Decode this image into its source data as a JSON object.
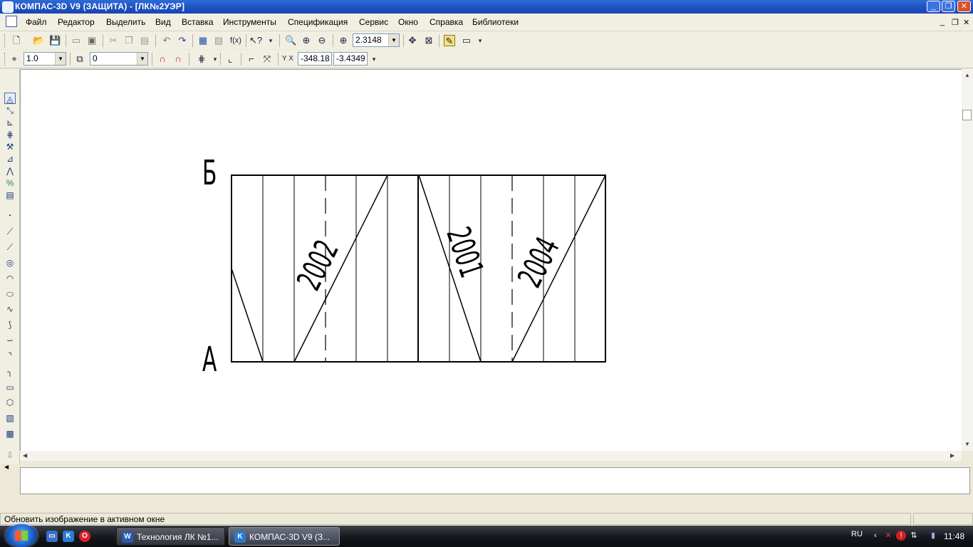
{
  "window": {
    "title": "КОМПАС-3D V9 (ЗАЩИТА) - [ЛК№2УЭР]",
    "controls": {
      "minimize": "_",
      "restore": "❐",
      "close": "✕"
    }
  },
  "menu": {
    "items": [
      "Файл",
      "Редактор",
      "Выделить",
      "Вид",
      "Вставка",
      "Инструменты",
      "Спецификация",
      "Сервис",
      "Окно",
      "Справка",
      "Библиотеки"
    ],
    "doc_controls": {
      "minimize": "_",
      "restore": "❐",
      "close": "✕"
    }
  },
  "toolbar1": {
    "zoom_value": "2.3148"
  },
  "toolbar2": {
    "line_scale": "1.0",
    "layer": "0",
    "coord_x": "-348.18",
    "coord_y": "-3.4349"
  },
  "drawing": {
    "label_top": "Б",
    "label_bottom": "А",
    "labels": [
      "2002",
      "2001",
      "2004"
    ]
  },
  "status": {
    "text": "Обновить изображение в активном окне"
  },
  "taskbar": {
    "tasks": [
      {
        "label": "Технология ЛК №1...",
        "active": false
      },
      {
        "label": "КОМПАС-3D V9 (З...",
        "active": true
      }
    ],
    "lang": "RU",
    "time": "11:48"
  },
  "icons": {
    "toolbar1": [
      "new-icon",
      "open-icon",
      "save-icon",
      "print-icon",
      "print-preview-icon",
      "cut-icon",
      "copy-icon",
      "paste-icon",
      "undo-icon",
      "redo-icon",
      "manager-icon",
      "properties-icon",
      "function-icon",
      "help-cursor-icon",
      "zoom-in-icon",
      "zoom-window-icon",
      "zoom-out-icon",
      "zoom-scale-icon",
      "pan-icon",
      "zoom-all-icon",
      "refresh-icon",
      "display-mode-icon"
    ],
    "left_panel": [
      "geometry-icon",
      "dimensions-icon",
      "symbols-icon",
      "edit-icon",
      "parametric-icon",
      "measure-icon",
      "select-icon",
      "spec-icon",
      "report-icon",
      "point-icon",
      "auxiliary-line-icon",
      "segment-icon",
      "circle-icon",
      "arc-icon",
      "ellipse-icon",
      "polyline-icon",
      "nurbs-icon",
      "bezier-icon",
      "chamfer-icon",
      "fillet-icon",
      "rectangle-icon",
      "polygon-icon",
      "hatch-icon",
      "fill-icon"
    ]
  }
}
